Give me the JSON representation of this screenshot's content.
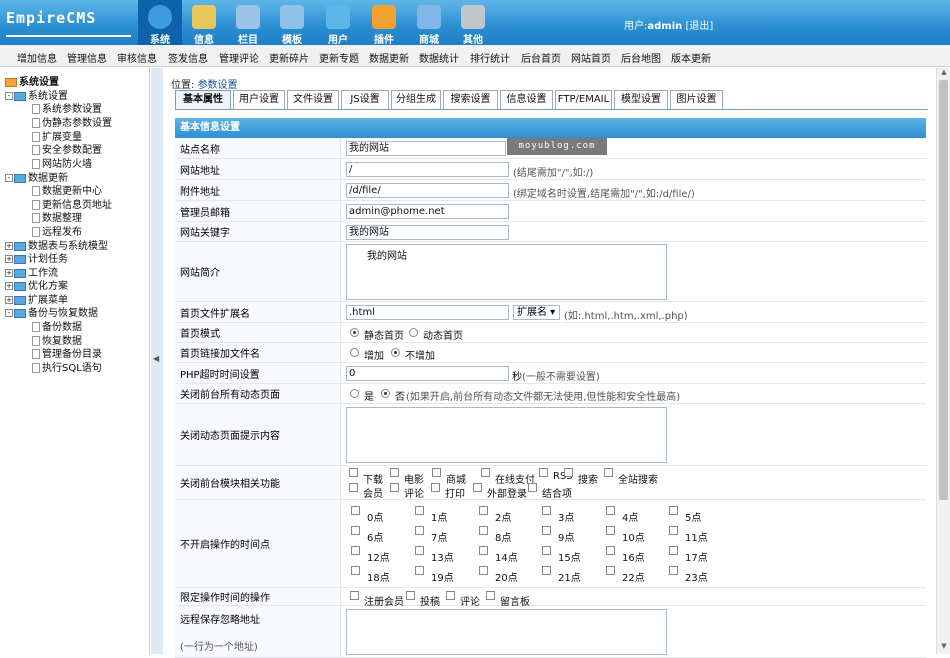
{
  "app": {
    "logo": "EmpireCMS",
    "user_label": "用户:",
    "user_name": "admin",
    "logout": "[退出]"
  },
  "topnav": [
    {
      "label": "系统",
      "icon": "globe-icon",
      "color": "#3d9be0"
    },
    {
      "label": "信息",
      "icon": "document-edit-icon",
      "color": "#e8c75a"
    },
    {
      "label": "栏目",
      "icon": "folder-icon",
      "color": "#9cc3e8"
    },
    {
      "label": "模板",
      "icon": "template-icon",
      "color": "#8fc0ea"
    },
    {
      "label": "用户",
      "icon": "user-icon",
      "color": "#5cb6ea"
    },
    {
      "label": "插件",
      "icon": "tools-icon",
      "color": "#f0a030"
    },
    {
      "label": "商城",
      "icon": "shop-icon",
      "color": "#7fb8e6"
    },
    {
      "label": "其他",
      "icon": "gear-icon",
      "color": "#bfc6cc"
    }
  ],
  "subnav": [
    "增加信息",
    "管理信息",
    "审核信息",
    "签发信息",
    "管理评论",
    "更新碎片",
    "更新专题",
    "数据更新",
    "数据统计",
    "排行统计",
    "后台首页",
    "网站首页",
    "后台地图",
    "版本更新"
  ],
  "sidebar": {
    "root": "系统设置",
    "nodes": [
      {
        "label": "系统设置",
        "type": "folder",
        "sign": "-"
      },
      {
        "label": "系统参数设置",
        "type": "doc"
      },
      {
        "label": "伪静态参数设置",
        "type": "doc"
      },
      {
        "label": "扩展变量",
        "type": "doc"
      },
      {
        "label": "安全参数配置",
        "type": "doc"
      },
      {
        "label": "网站防火墙",
        "type": "doc"
      },
      {
        "label": "数据更新",
        "type": "folder",
        "sign": "-"
      },
      {
        "label": "数据更新中心",
        "type": "doc"
      },
      {
        "label": "更新信息页地址",
        "type": "doc"
      },
      {
        "label": "数据整理",
        "type": "doc"
      },
      {
        "label": "远程发布",
        "type": "doc"
      },
      {
        "label": "数据表与系统模型",
        "type": "folder",
        "sign": "+"
      },
      {
        "label": "计划任务",
        "type": "folder",
        "sign": "+"
      },
      {
        "label": "工作流",
        "type": "folder",
        "sign": "+"
      },
      {
        "label": "优化方案",
        "type": "folder",
        "sign": "+"
      },
      {
        "label": "扩展菜单",
        "type": "folder",
        "sign": "+"
      },
      {
        "label": "备份与恢复数据",
        "type": "folder",
        "sign": "-"
      },
      {
        "label": "备份数据",
        "type": "doc"
      },
      {
        "label": "恢复数据",
        "type": "doc"
      },
      {
        "label": "管理备份目录",
        "type": "doc"
      },
      {
        "label": "执行SQL语句",
        "type": "doc"
      }
    ]
  },
  "breadcrumb": {
    "prefix": "位置:",
    "current": "参数设置"
  },
  "tabs": [
    "基本属性",
    "用户设置",
    "文件设置",
    "JS设置",
    "分组生成",
    "搜索设置",
    "信息设置",
    "FTP/EMAIL",
    "模型设置",
    "图片设置"
  ],
  "form": {
    "title": "基本信息设置",
    "site_name": {
      "label": "站点名称",
      "value": "我的网站"
    },
    "site_url": {
      "label": "网站地址",
      "value": "/",
      "hint": "(结尾需加\"/\",如:/)"
    },
    "file_url": {
      "label": "附件地址",
      "value": "/d/file/",
      "hint": "(绑定域名时设置,结尾需加\"/\",如:/d/file/)"
    },
    "email": {
      "label": "管理员邮箱",
      "value": "admin@phome.net"
    },
    "keywords": {
      "label": "网站关键字",
      "value": "我的网站"
    },
    "intro": {
      "label": "网站简介",
      "value": "我的网站"
    },
    "index_ext": {
      "label": "首页文件扩展名",
      "value": ".html",
      "select": "扩展名",
      "hint": "(如:.html,.htm,.xml,.php)"
    },
    "index_mode": {
      "label": "首页模式",
      "options": [
        "静态首页",
        "动态首页"
      ],
      "selected": 0
    },
    "index_link": {
      "label": "首页链接加文件名",
      "options": [
        "增加",
        "不增加"
      ],
      "selected": 1
    },
    "php_timeout": {
      "label": "PHP超时时间设置",
      "value": "0",
      "unit": "秒",
      "hint": "(一般不需要设置)"
    },
    "close_dynamic": {
      "label": "关闭前台所有动态页面",
      "options": [
        "是",
        "否"
      ],
      "selected": 1,
      "hint": "(如果开启,前台所有动态文件都无法使用,但性能和安全性最高)"
    },
    "close_tip": {
      "label": "关闭动态页面提示内容",
      "value": ""
    },
    "close_modules": {
      "label": "关闭前台模块相关功能",
      "row1": [
        "下载",
        "电影",
        "商城",
        "在线支付",
        "RSS",
        "搜索",
        "全站搜索"
      ],
      "row2": [
        "会员",
        "评论",
        "打印",
        "外部登录",
        "结合项"
      ]
    },
    "hours": {
      "label": "不开启操作的时间点",
      "items": [
        "0点",
        "1点",
        "2点",
        "3点",
        "4点",
        "5点",
        "6点",
        "7点",
        "8点",
        "9点",
        "10点",
        "11点",
        "12点",
        "13点",
        "14点",
        "15点",
        "16点",
        "17点",
        "18点",
        "19点",
        "20点",
        "21点",
        "22点",
        "23点"
      ]
    },
    "limit_ops": {
      "label": "限定操作时间的操作",
      "items": [
        "注册会员",
        "投稿",
        "评论",
        "留言板"
      ]
    },
    "ignore_addr": {
      "label": "远程保存忽略地址",
      "sub": "(一行为一个地址)",
      "value": ""
    }
  },
  "watermark": "moyublog.com"
}
